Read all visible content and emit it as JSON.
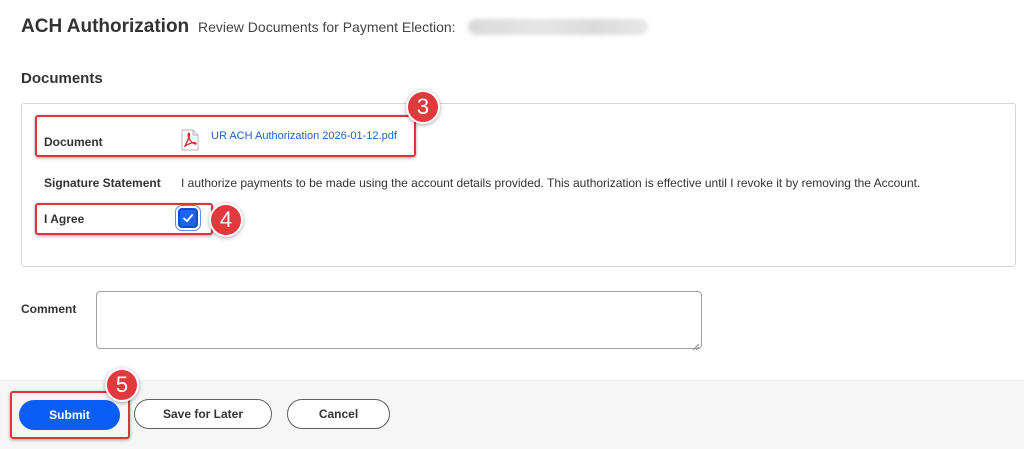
{
  "header": {
    "title": "ACH Authorization",
    "subtitle": "Review Documents for Payment Election:"
  },
  "documents": {
    "section_title": "Documents",
    "document_label": "Document",
    "document_file": "UR ACH Authorization 2026-01-12.pdf",
    "document_icon": "pdf-icon",
    "signature_label": "Signature Statement",
    "signature_text": "I authorize payments to be made using the account details provided. This authorization is effective until I revoke it by removing the Account.",
    "agree_label": "I Agree",
    "agree_checked": true
  },
  "comment": {
    "label": "Comment",
    "value": ""
  },
  "footer": {
    "submit_label": "Submit",
    "save_later_label": "Save for Later",
    "cancel_label": "Cancel"
  },
  "annotations": {
    "step3": "3",
    "step4": "4",
    "step5": "5",
    "highlight_color": "#e0343b"
  },
  "colors": {
    "primary": "#0a5df5",
    "link": "#1c61c9"
  }
}
